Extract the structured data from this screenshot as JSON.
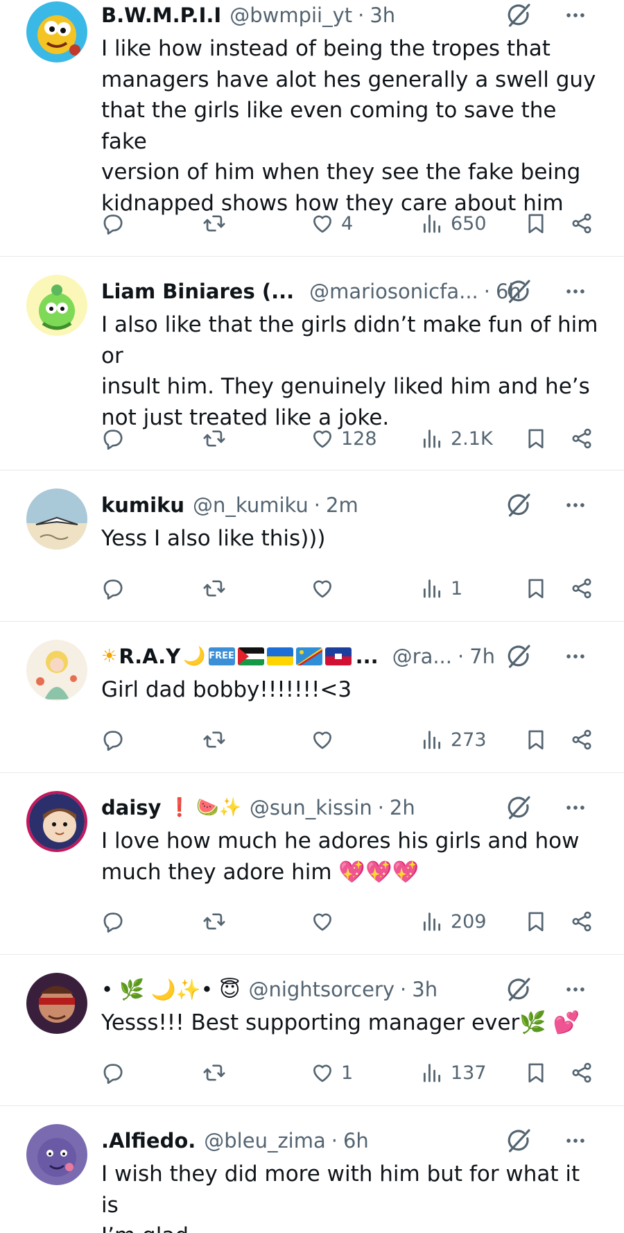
{
  "posts": [
    {
      "display_name": "B.W.M.P.I.I",
      "handle": "@bwmpii_yt",
      "sep": "·",
      "time": "3h",
      "lines": [
        "I like how instead of being the tropes that",
        "managers have alot hes generally a swell guy",
        "that the girls like even coming to save the fake",
        "version of him when they see the fake being",
        "kidnapped shows how they care about him"
      ],
      "likes": "4",
      "views": "650"
    },
    {
      "display_name": "Liam Biniares (...",
      "handle": "@mariosonicfa...",
      "sep": "·",
      "time": "6h",
      "lines": [
        "I also like that the girls didn’t make fun of him or",
        "insult him. They genuinely liked him and he’s",
        "not just treated like a joke."
      ],
      "likes": "128",
      "views": "2.1K"
    },
    {
      "display_name": "kumiku",
      "handle": "@n_kumiku",
      "sep": "·",
      "time": "2m",
      "lines": [
        "Yess I also like this)))"
      ],
      "likes": "",
      "views": "1"
    },
    {
      "display_name": "R.A.Y",
      "display_prefix": "☀",
      "display_suffix": "🌙",
      "flag_label": "FREE",
      "name_ellipsis": "...",
      "handle": "@ra...",
      "sep": "·",
      "time": "7h",
      "lines": [
        "Girl dad bobby!!!!!!!<3"
      ],
      "likes": "",
      "views": "273"
    },
    {
      "display_name": "daisy",
      "display_suffix": "❗ 🍉✨",
      "handle": "@sun_kissin",
      "sep": "·",
      "time": "2h",
      "lines": [
        "I love how much he adores his girls and how",
        "much they adore him"
      ],
      "hearts": "💖💖💖",
      "likes": "",
      "views": "209"
    },
    {
      "display_name": "• 🌿 🌙✨• 😇",
      "handle": "@nightsorcery",
      "sep": "·",
      "time": "3h",
      "lines": [
        "Yesss!!! Best supporting manager ever"
      ],
      "line_suffix": "🌿 💕",
      "likes": "1",
      "views": "137"
    },
    {
      "display_name": ".Alfiedo.",
      "handle": "@bleu_zima",
      "sep": "·",
      "time": "6h",
      "lines": [
        "I wish they did more with him but for what it is",
        "I’m glad"
      ]
    }
  ],
  "icons": {
    "reply": "reply-icon",
    "repost": "repost-icon",
    "like": "heart-icon",
    "views": "views-icon",
    "bookmark": "bookmark-icon",
    "share": "share-icon",
    "grok": "grok-icon",
    "more": "more-dots-icon"
  },
  "colors": {
    "text": "#0f1419",
    "secondary": "#536471",
    "divider": "#e6e9ec"
  }
}
